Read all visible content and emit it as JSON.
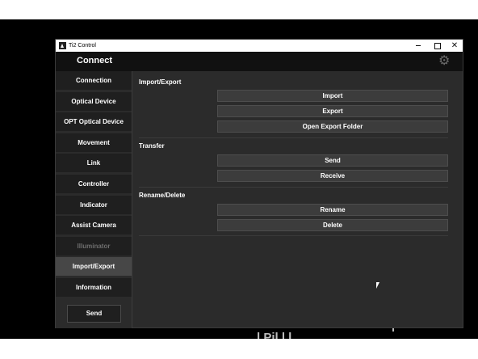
{
  "window": {
    "title": "Ti2 Control"
  },
  "header": {
    "title": "Connect",
    "settings_icon": "gear-icon"
  },
  "sidebar": {
    "items": [
      {
        "label": "Connection",
        "state": "normal"
      },
      {
        "label": "Optical Device",
        "state": "normal"
      },
      {
        "label": "OPT Optical Device",
        "state": "normal"
      },
      {
        "label": "Movement",
        "state": "normal"
      },
      {
        "label": "Link",
        "state": "normal"
      },
      {
        "label": "Controller",
        "state": "normal"
      },
      {
        "label": "Indicator",
        "state": "normal"
      },
      {
        "label": "Assist Camera",
        "state": "normal"
      },
      {
        "label": "Illuminator",
        "state": "disabled"
      },
      {
        "label": "Import/Export",
        "state": "active"
      },
      {
        "label": "Information",
        "state": "normal"
      }
    ],
    "send_label": "Send"
  },
  "main": {
    "sections": [
      {
        "title": "Import/Export",
        "buttons": [
          "Import",
          "Export",
          "Open Export Folder"
        ]
      },
      {
        "title": "Transfer",
        "buttons": [
          "Send",
          "Receive"
        ]
      },
      {
        "title": "Rename/Delete",
        "buttons": [
          "Rename",
          "Delete"
        ]
      }
    ]
  },
  "colors": {
    "window_bg": "#2b2b2b",
    "header_bg": "#111111",
    "nav_item_bg": "#1f1f1f",
    "nav_active_bg": "#474747",
    "button_bg": "#3c3c3c",
    "disabled_text": "#6e6e6e"
  }
}
